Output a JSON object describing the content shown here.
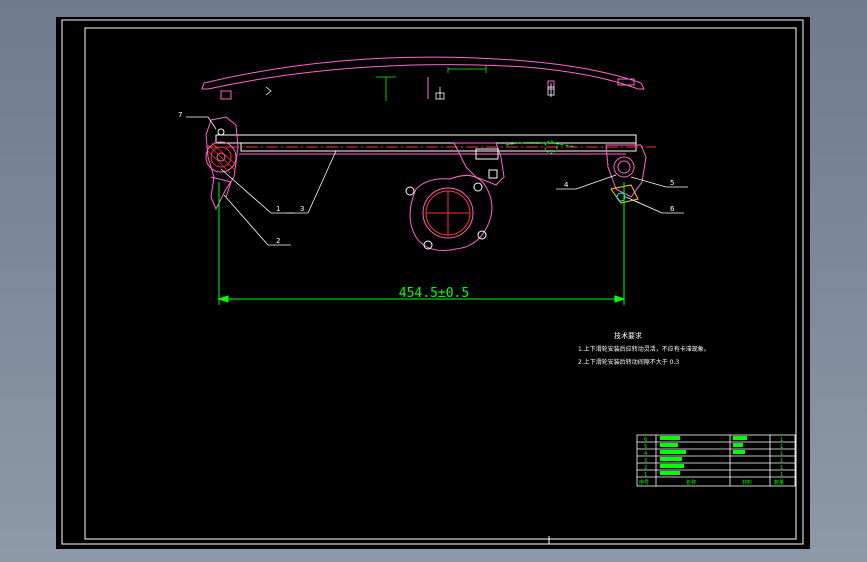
{
  "drawing": {
    "dimension_text": "454.5±0.5",
    "balloons": [
      "7",
      "1",
      "2",
      "3",
      "4",
      "5",
      "6"
    ],
    "notes": {
      "title": "技术要求",
      "lines": [
        "1.上下滑轮安装后应转动灵活，不应有卡滞现象。",
        "2.上下滑轮安装后转动间隙不大于 0.3"
      ]
    },
    "parts_table": {
      "headers": [
        "序号",
        "名称",
        "材料",
        "数量"
      ],
      "rows": [
        [
          "6",
          "",
          "",
          "1"
        ],
        [
          "5",
          "",
          "",
          "1"
        ],
        [
          "4",
          "",
          "",
          "1"
        ],
        [
          "3",
          "",
          "",
          "1"
        ],
        [
          "2",
          "",
          "",
          "1"
        ],
        [
          "1",
          "",
          "",
          "1"
        ]
      ]
    },
    "colors": {
      "background": "#000000",
      "border": "#ffffff",
      "part_outline": "#ff66cc",
      "dimension": "#00ff00",
      "centerline": "#ff3333",
      "leader": "#ffffff"
    }
  }
}
